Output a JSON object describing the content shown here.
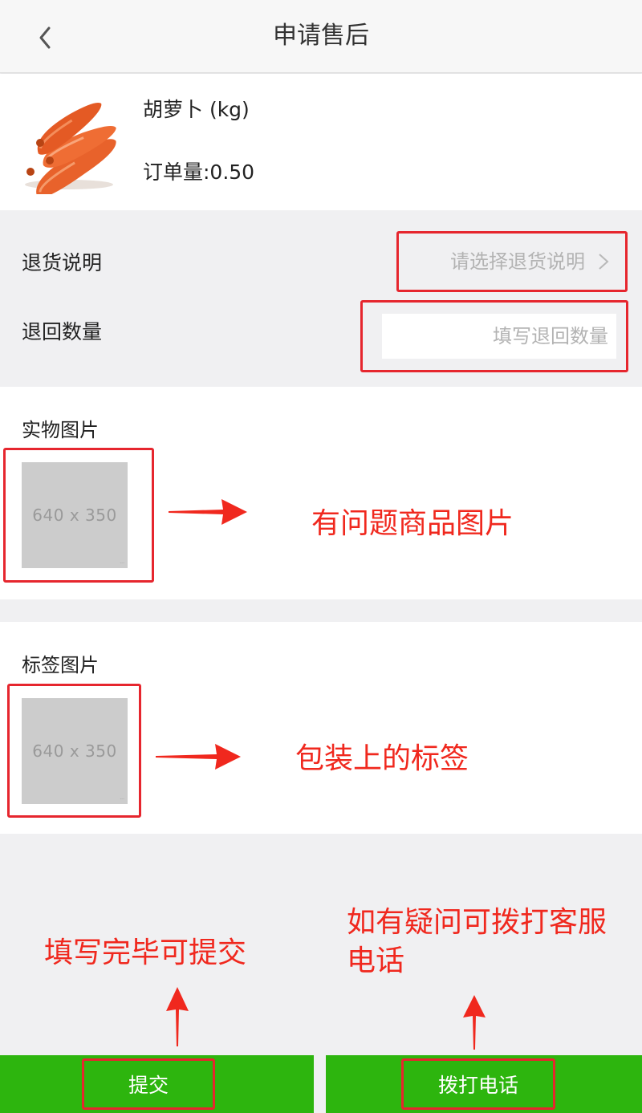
{
  "header": {
    "title": "申请售后",
    "back_icon": "chevron-left-icon"
  },
  "product": {
    "name": "胡萝卜 (kg)",
    "order_qty": "订单量:0.50",
    "image": "carrot-image"
  },
  "form": {
    "return_reason_label": "退货说明",
    "return_reason_placeholder": "请选择退货说明",
    "return_qty_label": "退回数量",
    "return_qty_placeholder": "填写退回数量"
  },
  "photos": {
    "item_label": "实物图片",
    "item_placeholder": "640 x 350",
    "tag_label": "标签图片",
    "tag_placeholder": "640 x 350"
  },
  "annotations": {
    "item_photo": "有问题商品图片",
    "tag_photo": "包装上的标签",
    "submit_hint": "填写完毕可提交",
    "call_hint": "如有疑问可拨打客服电话"
  },
  "buttons": {
    "submit": "提交",
    "call": "拨打电话"
  },
  "colors": {
    "accent_green": "#2db50e",
    "annotation_red": "#f0281e"
  }
}
